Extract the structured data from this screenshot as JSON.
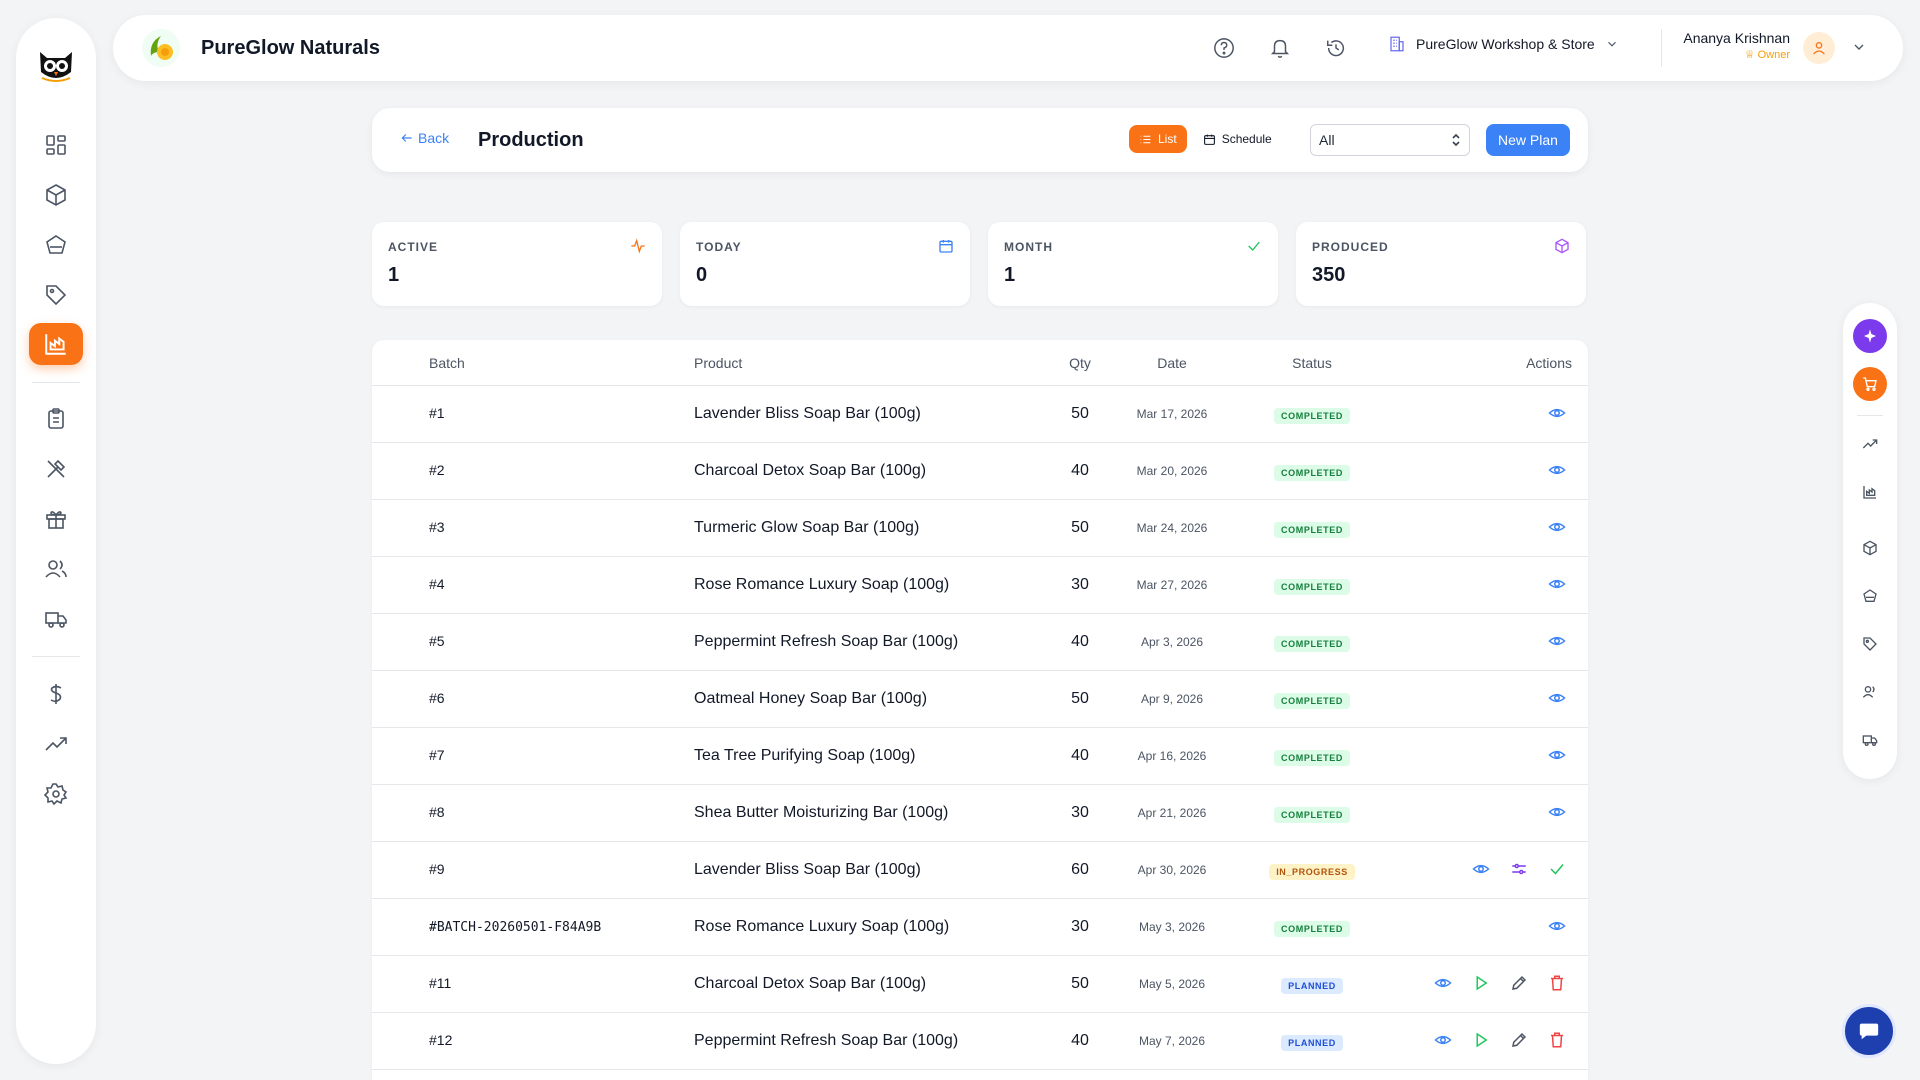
{
  "app": {
    "brand_name": "PureGlow Naturals"
  },
  "header": {
    "store_name": "PureGlow Workshop & Store",
    "user_name": "Ananya Krishnan",
    "user_role": "♕ Owner"
  },
  "toolbar": {
    "back_label": "Back",
    "title": "Production",
    "view_list_label": "List",
    "view_schedule_label": "Schedule",
    "filter_value": "All",
    "new_plan_label": "New Plan"
  },
  "stats": [
    {
      "label": "ACTIVE",
      "value": "1",
      "icon": "activity-icon",
      "color": "#f97316"
    },
    {
      "label": "TODAY",
      "value": "0",
      "icon": "calendar-icon",
      "color": "#3b82f6"
    },
    {
      "label": "MONTH",
      "value": "1",
      "icon": "check-icon",
      "color": "#22c55e"
    },
    {
      "label": "PRODUCED",
      "value": "350",
      "icon": "box-icon",
      "color": "#a855f7"
    }
  ],
  "table": {
    "headers": {
      "batch": "Batch",
      "product": "Product",
      "qty": "Qty",
      "date": "Date",
      "status": "Status",
      "actions": "Actions"
    },
    "rows": [
      {
        "batch": "#1",
        "product": "Lavender Bliss Soap Bar (100g)",
        "qty": "50",
        "date": "Mar 17, 2026",
        "status": "COMPLETED"
      },
      {
        "batch": "#2",
        "product": "Charcoal Detox Soap Bar (100g)",
        "qty": "40",
        "date": "Mar 20, 2026",
        "status": "COMPLETED"
      },
      {
        "batch": "#3",
        "product": "Turmeric Glow Soap Bar (100g)",
        "qty": "50",
        "date": "Mar 24, 2026",
        "status": "COMPLETED"
      },
      {
        "batch": "#4",
        "product": "Rose Romance Luxury Soap (100g)",
        "qty": "30",
        "date": "Mar 27, 2026",
        "status": "COMPLETED"
      },
      {
        "batch": "#5",
        "product": "Peppermint Refresh Soap Bar (100g)",
        "qty": "40",
        "date": "Apr 3, 2026",
        "status": "COMPLETED"
      },
      {
        "batch": "#6",
        "product": "Oatmeal Honey Soap Bar (100g)",
        "qty": "50",
        "date": "Apr 9, 2026",
        "status": "COMPLETED"
      },
      {
        "batch": "#7",
        "product": "Tea Tree Purifying Soap (100g)",
        "qty": "40",
        "date": "Apr 16, 2026",
        "status": "COMPLETED"
      },
      {
        "batch": "#8",
        "product": "Shea Butter Moisturizing Bar (100g)",
        "qty": "30",
        "date": "Apr 21, 2026",
        "status": "COMPLETED"
      },
      {
        "batch": "#9",
        "product": "Lavender Bliss Soap Bar (100g)",
        "qty": "60",
        "date": "Apr 30, 2026",
        "status": "IN_PROGRESS"
      },
      {
        "batch": "#BATCH-20260501-F84A9B",
        "product": "Rose Romance Luxury Soap (100g)",
        "qty": "30",
        "date": "May 3, 2026",
        "status": "COMPLETED"
      },
      {
        "batch": "#11",
        "product": "Charcoal Detox Soap Bar (100g)",
        "qty": "50",
        "date": "May 5, 2026",
        "status": "PLANNED"
      },
      {
        "batch": "#12",
        "product": "Peppermint Refresh Soap Bar (100g)",
        "qty": "40",
        "date": "May 7, 2026",
        "status": "PLANNED"
      }
    ]
  },
  "colors": {
    "accent": "#f97316",
    "primary": "#3b82f6",
    "completed": "#15803d",
    "in_progress": "#b45309",
    "planned": "#1d4ed8",
    "danger": "#ef4444"
  }
}
